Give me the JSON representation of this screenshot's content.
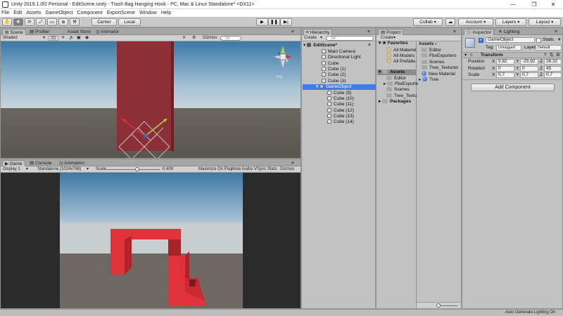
{
  "window": {
    "title": "Unity 2019.1.0f2 Personal - EditScene.unity - Trash Bag Hanging Hook - PC, Mac & Linux Standalone* <DX11>",
    "minimize": "—",
    "maximize": "❐",
    "close": "✕"
  },
  "menu": [
    "File",
    "Edit",
    "Assets",
    "GameObject",
    "Component",
    "ExportScene",
    "Window",
    "Help"
  ],
  "toolbar": {
    "pivot_label": "Center",
    "space_label": "Local",
    "collab_label": "Collab",
    "account_label": "Account",
    "layers_label": "Layers",
    "layout_label": "Layout"
  },
  "scene_panel": {
    "tabs": [
      "Scene",
      "Profiler",
      "Asset Store",
      "Animator"
    ],
    "shading": "Shaded",
    "mode_2d": "2D",
    "gizmos": "Gizmos",
    "search_placeholder": "All",
    "view_label": "Iso"
  },
  "game_panel": {
    "tabs": [
      "Game",
      "Console",
      "Animation"
    ],
    "display": "Display 1",
    "resolution": "Standalone (1024x768)",
    "scale_label": "Scale",
    "scale_value": "0.609",
    "scale_fraction": 0.58,
    "maximize_on_play": "Maximize On Play",
    "mute_audio": "Mute Audio",
    "vsync": "VSync",
    "stats": "Stats",
    "gizmos": "Gizmos"
  },
  "hierarchy": {
    "tab": "Hierarchy",
    "create": "Create",
    "search_placeholder": "All",
    "scene": "EditScene*",
    "items": [
      {
        "label": "Main Camera"
      },
      {
        "label": "Directional Light"
      },
      {
        "label": "Cube"
      },
      {
        "label": "Cube (1)"
      },
      {
        "label": "Cube (2)"
      },
      {
        "label": "Cube (3)"
      }
    ],
    "selected": "GameObject",
    "children": [
      {
        "label": "Cube (9)"
      },
      {
        "label": "Cube (10)"
      },
      {
        "label": "Cube (11)"
      },
      {
        "label": "Cube (12)"
      },
      {
        "label": "Cube (13)"
      },
      {
        "label": "Cube (14)"
      }
    ]
  },
  "project": {
    "tab": "Project",
    "create": "Create",
    "favorites_header": "Favorites",
    "favorites": [
      {
        "label": "All Material"
      },
      {
        "label": "All Models"
      },
      {
        "label": "All Prefabs"
      }
    ],
    "assets_header": "Assets",
    "asset_folders": [
      {
        "label": "Editor"
      },
      {
        "label": "FbxExporte"
      },
      {
        "label": "Scenes"
      },
      {
        "label": "Tree_Textu"
      }
    ],
    "packages_header": "Packages",
    "right_header": "Assets",
    "right_items": [
      {
        "label": "Editor",
        "icon": "folder-icon"
      },
      {
        "label": "FbxExporters",
        "icon": "folder-icon"
      },
      {
        "label": "Scenes",
        "icon": "folder-icon"
      },
      {
        "label": "Tree_Textures",
        "icon": "folder-icon"
      },
      {
        "label": "New Material",
        "icon": "material-icon"
      },
      {
        "label": "Tree",
        "icon": "prefab-icon"
      }
    ],
    "zoom_fraction": 0.1
  },
  "inspector": {
    "tabs": [
      "Inspector",
      "Lighting"
    ],
    "object_name": "GameObject",
    "static_label": "Static",
    "tag_label": "Tag",
    "tag_value": "Untagged",
    "layer_label": "Layer",
    "layer_value": "Default",
    "transform_label": "Transform",
    "position_label": "Position",
    "rotation_label": "Rotation",
    "scale_label": "Scale",
    "position": {
      "x": "5.82",
      "y": "-25.92",
      "z": "26.32"
    },
    "rotation": {
      "x": "0",
      "y": "0",
      "z": "45"
    },
    "scale": {
      "x": "0.7",
      "y": "0.7",
      "z": "0.7"
    },
    "add_component": "Add Component"
  },
  "statusbar": {
    "text": "Auto Generate Lighting On"
  },
  "colors": {
    "selection": "#3e7ce8",
    "hook_red": "#e0323a",
    "scene_red": "#8d2f37"
  }
}
